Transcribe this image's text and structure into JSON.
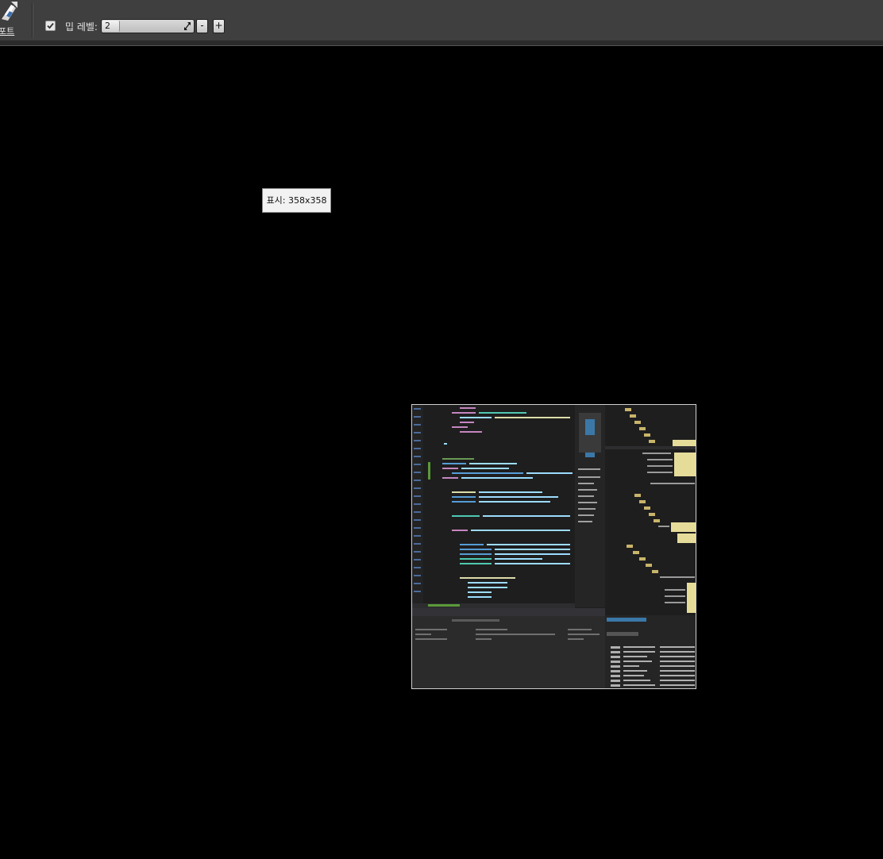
{
  "toolbar": {
    "export_label": "포트",
    "export_icon": "export-icon",
    "mip_checkbox_checked": true,
    "mip_label": "밉 레벨:",
    "mip_value": "2",
    "decrement_label": "-",
    "increment_label": "+"
  },
  "tooltip": {
    "text": "표시: 358x358"
  },
  "preview": {
    "description_icon": "texture-preview-image"
  }
}
